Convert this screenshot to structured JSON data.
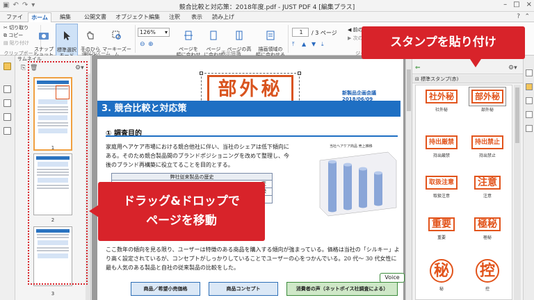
{
  "window": {
    "title": "競合比較と対応策：2018年度.pdf - JUST PDF 4 [編集プラス]",
    "controls": [
      "–",
      "□",
      "×"
    ]
  },
  "tabs": [
    "ファイル",
    "ホーム",
    "編集",
    "公開文書",
    "オブジェクト編集",
    "注釈",
    "表示",
    "読み上げ"
  ],
  "ribbon": {
    "cut": "切り取り",
    "copy": "コピー",
    "paste": "貼り付け",
    "clipboard_group": "クリップボード",
    "snapshot": "スナップ\nショット",
    "standard_select": "標準選択\nモード",
    "hand": "手のひら\nモード",
    "marquee_zoom": "マーキーズーム\nモード",
    "select_zoom_group": "選択とズーム",
    "zoom_value": "126%",
    "fit_width": "ページを\n幅に合わせる",
    "fit_page": "ページ\nに合わせる",
    "fit_height": "ページの高さ\nに合わせる",
    "fit_drawing": "描画領域の\n幅に合わせる",
    "display_group": "表示倍率",
    "page_current": "1",
    "page_total": "/ 3 ページ",
    "prev_view": "前の表",
    "next_view": "次の表",
    "jump_group": "ジャ"
  },
  "thumbnails": {
    "header": "サムネイル",
    "pages": [
      "1",
      "2",
      "3"
    ]
  },
  "document": {
    "stamp_text": "部外秘",
    "meta": "新製品企画会議  2018/06/09",
    "section_title": "3. 競合比較と対応策",
    "subheading": "① 調査目的",
    "para1": "家庭用ヘアケア市場における競合他社に伴い、当社のシェアは低下傾向にある。そのため競合製品間のブランドポジショニングを改めて整理し、今後のブランド再構築に役立てることを目的とする。",
    "table_title": "弊社従来製品の歴史",
    "table_frag1": "変",
    "table_frag2": "録",
    "chart_title": "当社ヘアケア商品 売上推移",
    "para2": "ここ数年の傾向を見る限り、ユーザーは特徴のある商品を購入する傾向が強まっている。価格は当社の「シルキー」より高く設定されているが、コンセプトがしっかりしていることでユーザーの心をつかんでいる。20 代〜 30 代女性に最も人気のある製品と自社の従来製品の比較をした。",
    "box1": "商品／希望小売価格",
    "box2": "商品コンセプト",
    "box3": "消費者の声（ネットボイス社調査による）",
    "voice": "Voice"
  },
  "chart_data": {
    "type": "bar",
    "title": "当社ヘアケア商品 売上推移",
    "style": "3d-cylinder",
    "values": [
      78,
      70,
      60,
      50
    ],
    "colors": {
      "bar": "#8aa6d8",
      "bar_top": "#b7caec"
    }
  },
  "stamp_panel": {
    "category": "標準スタンプ(赤)",
    "stamps": [
      {
        "mark": "社外秘",
        "name": "社外秘",
        "style": "rect"
      },
      {
        "mark": "部外秘",
        "name": "部外秘",
        "style": "rect"
      },
      {
        "mark": "持出厳禁",
        "name": "持出厳禁",
        "style": "rect"
      },
      {
        "mark": "持出禁止",
        "name": "持出禁止",
        "style": "rect"
      },
      {
        "mark": "取扱注意",
        "name": "取扱注意",
        "style": "rect"
      },
      {
        "mark": "注意",
        "name": "注意",
        "style": "rect"
      },
      {
        "mark": "重要",
        "name": "重要",
        "style": "rect"
      },
      {
        "mark": "極秘",
        "name": "極秘",
        "style": "rect"
      },
      {
        "mark": "秘",
        "name": "秘",
        "style": "circle"
      },
      {
        "mark": "控",
        "name": "控",
        "style": "circle"
      }
    ]
  },
  "callouts": {
    "drag_drop": "ドラッグ&ドロップで\nページを移動",
    "paste_stamp": "スタンプを貼り付け"
  },
  "colors": {
    "accent": "#1e6fc3",
    "stamp": "#e2541b",
    "callout": "#d8232a"
  }
}
